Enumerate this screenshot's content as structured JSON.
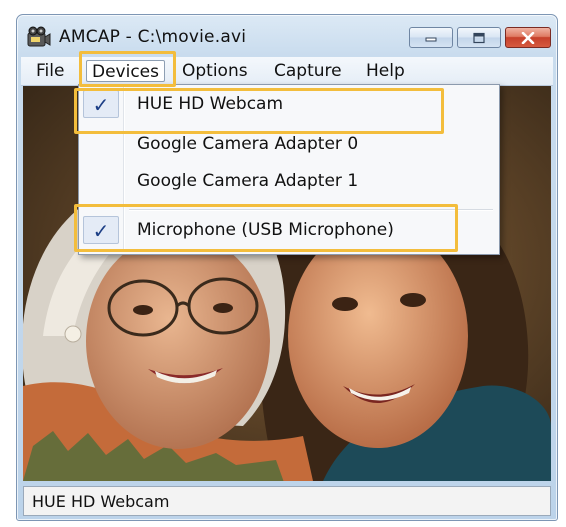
{
  "window": {
    "title": "AMCAP - C:\\movie.avi",
    "app_icon": "camera-app-icon",
    "controls": [
      "minimize-icon",
      "maximize-icon",
      "close-icon"
    ]
  },
  "menubar": {
    "items": [
      {
        "label": "File"
      },
      {
        "label": "Devices",
        "active": true
      },
      {
        "label": "Options"
      },
      {
        "label": "Capture"
      },
      {
        "label": "Help"
      }
    ]
  },
  "devices_menu": {
    "items": [
      {
        "label": "HUE HD Webcam",
        "checked": true,
        "highlighted": true
      },
      {
        "label": "Google Camera Adapter 0",
        "checked": false
      },
      {
        "label": "Google Camera Adapter 1",
        "checked": false
      },
      {
        "label": "Microphone (USB Microphone)",
        "checked": true,
        "highlighted": true
      }
    ],
    "check_glyph": "✓"
  },
  "preview": {
    "content": "video-preview"
  },
  "statusbar": {
    "text": "HUE HD Webcam"
  },
  "colors": {
    "highlight": "#f3bd3c",
    "check": "#1d3f86"
  }
}
